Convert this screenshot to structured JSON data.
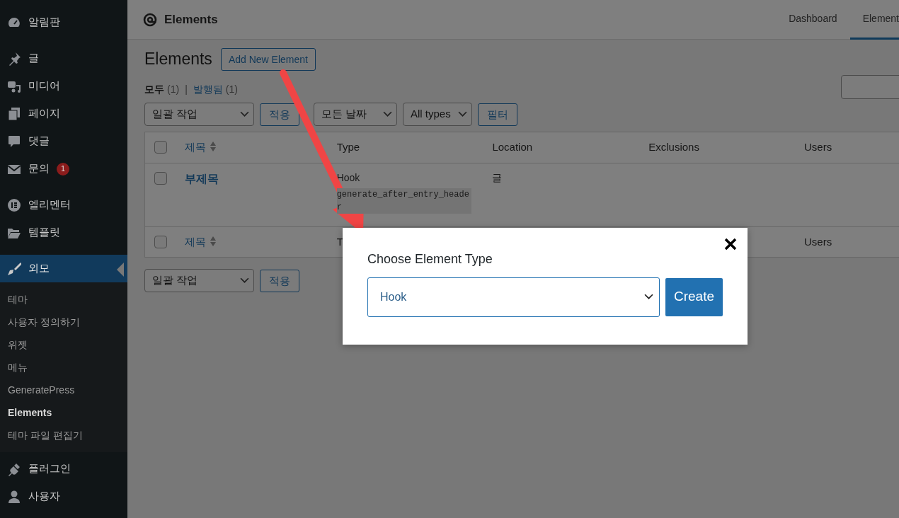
{
  "sidebar": {
    "groups": [
      {
        "items": [
          {
            "label": "알림판",
            "selected": false
          }
        ]
      },
      {
        "items": [
          {
            "label": "글",
            "selected": false
          },
          {
            "label": "미디어",
            "selected": false
          },
          {
            "label": "페이지",
            "selected": false
          },
          {
            "label": "댓글",
            "selected": false
          },
          {
            "label": "문의",
            "selected": false,
            "badge": "1"
          }
        ]
      },
      {
        "items": [
          {
            "label": "엘리멘터",
            "selected": false
          },
          {
            "label": "템플릿",
            "selected": false
          }
        ]
      },
      {
        "items": [
          {
            "label": "외모",
            "selected": true,
            "children": [
              {
                "label": "테마",
                "selected": false
              },
              {
                "label": "사용자 정의하기",
                "selected": false
              },
              {
                "label": "위젯",
                "selected": false
              },
              {
                "label": "메뉴",
                "selected": false
              },
              {
                "label": "GeneratePress",
                "selected": false
              },
              {
                "label": "Elements",
                "selected": true
              },
              {
                "label": "테마 파일 편집기",
                "selected": false
              }
            ]
          },
          {
            "label": "플러그인",
            "selected": false
          },
          {
            "label": "사용자",
            "selected": false
          }
        ]
      }
    ]
  },
  "header": {
    "title": "Elements",
    "tabs": [
      {
        "label": "Dashboard",
        "selected": false
      },
      {
        "label": "Element",
        "selected": true
      }
    ]
  },
  "page": {
    "title": "Elements",
    "add_button": "Add New Element",
    "view_separator": "|",
    "views": [
      {
        "label": "모두",
        "count": "(1)",
        "selected": true
      },
      {
        "label": "발행됨",
        "count": "(1)",
        "selected": false
      }
    ],
    "filters": [
      {
        "kind": "select",
        "label": "일괄 작업"
      },
      {
        "kind": "button",
        "label": "적용"
      },
      {
        "kind": "select",
        "label": "모든 날짜"
      },
      {
        "kind": "select",
        "label": "All types"
      },
      {
        "kind": "button",
        "label": "필터"
      }
    ],
    "table": {
      "columns": [
        {
          "label": "제목",
          "kind": "sortable"
        },
        {
          "label": "Type",
          "kind": "plain"
        },
        {
          "label": "Location",
          "kind": "plain"
        },
        {
          "label": "Exclusions",
          "kind": "plain"
        },
        {
          "label": "Users",
          "kind": "plain"
        }
      ],
      "header_checked": false,
      "rows": [
        {
          "checked": false,
          "title": "부제목",
          "type": "Hook",
          "hook": "generate_after_entry_header",
          "location": "글"
        }
      ],
      "footer": {
        "checked": false,
        "title": "제목",
        "type": "T",
        "users": "Users"
      }
    },
    "bottom_actions": [
      {
        "kind": "select",
        "label": "일괄 작업"
      },
      {
        "kind": "button",
        "label": "적용"
      }
    ]
  },
  "modal": {
    "title": "Choose Element Type",
    "select_value": "Hook",
    "button": "Create"
  }
}
